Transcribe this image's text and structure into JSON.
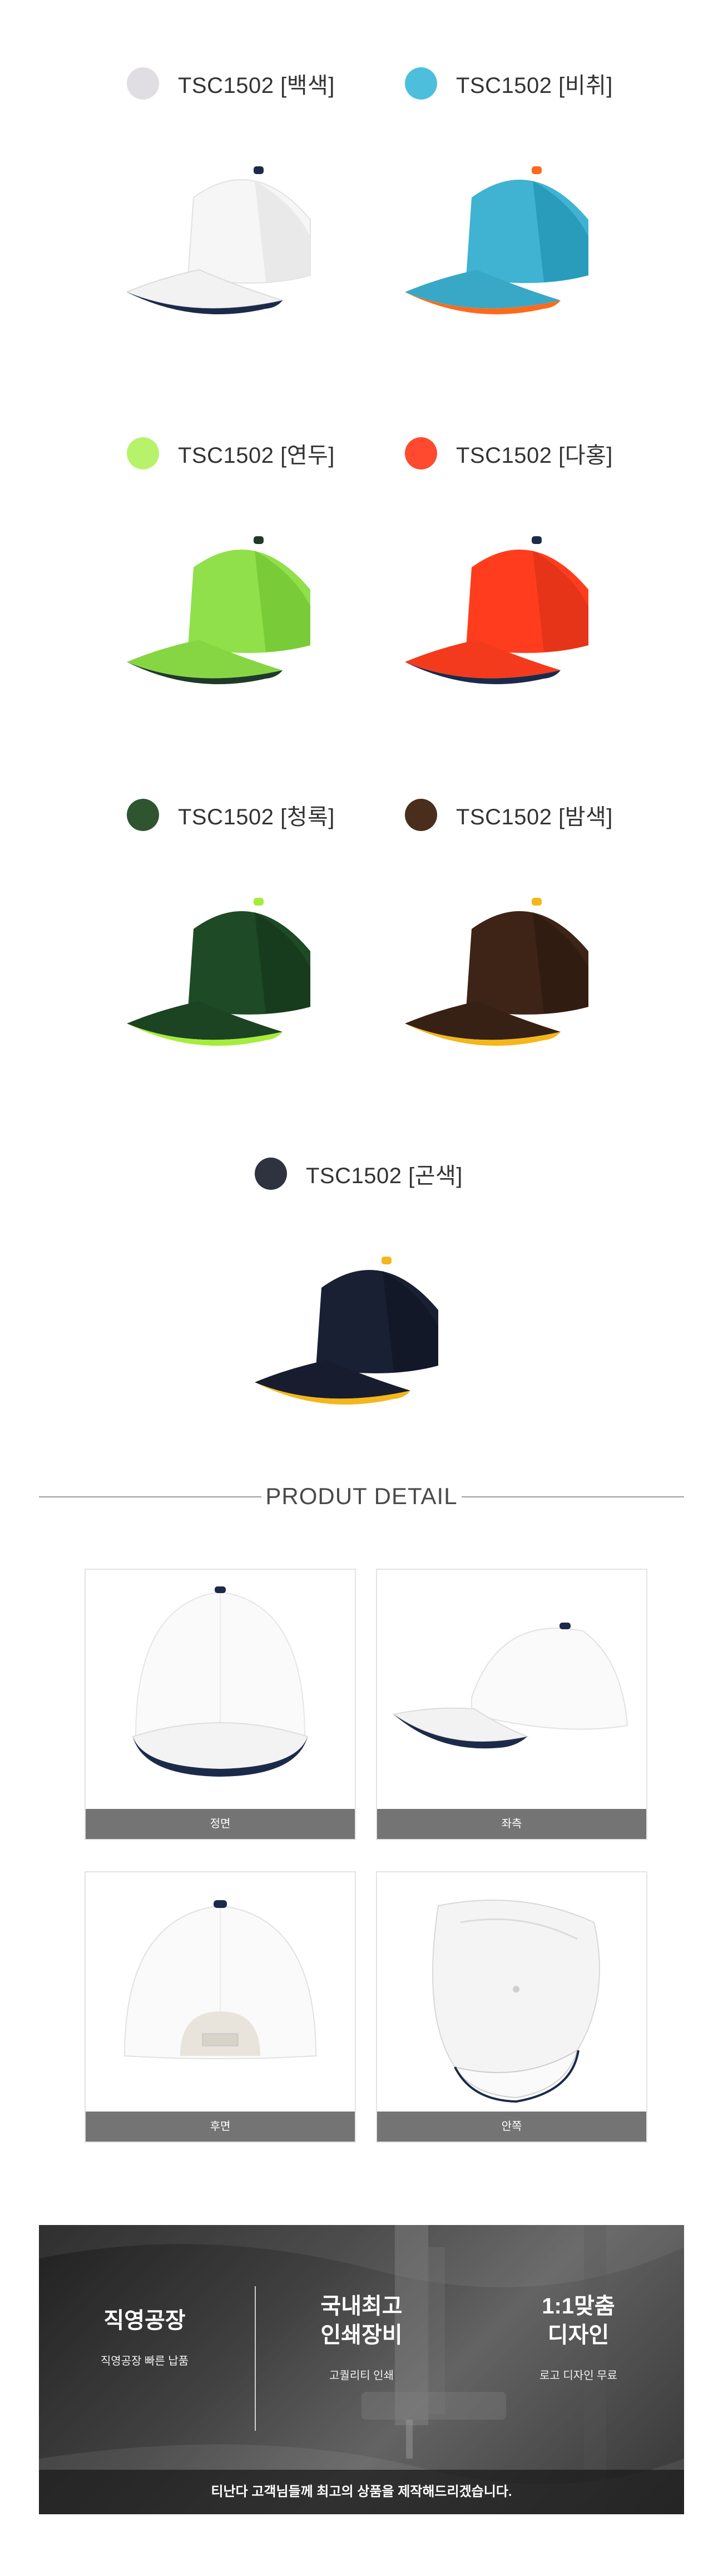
{
  "variants": [
    {
      "label": "TSC1502 [백색]",
      "swatch": "#e0dde3",
      "crown": "#f6f6f6",
      "shade": "#d9d9d9",
      "trim": "#1c2a4a",
      "button": "#1c2a4a"
    },
    {
      "label": "TSC1502 [비취]",
      "swatch": "#4dbfdc",
      "crown": "#3fb3d1",
      "shade": "#2a8aa6",
      "trim": "#ff6a1a",
      "button": "#ff6a1a"
    },
    {
      "label": "TSC1502 [연두]",
      "swatch": "#b7f36a",
      "crown": "#8fe04a",
      "shade": "#6cb32f",
      "trim": "#1f3a2a",
      "button": "#1f3a2a"
    },
    {
      "label": "TSC1502 [다홍]",
      "swatch": "#ff4a30",
      "crown": "#ff3d1e",
      "shade": "#cc2d14",
      "trim": "#1c2a4a",
      "button": "#1c2a4a"
    },
    {
      "label": "TSC1502 [청록]",
      "swatch": "#2e5530",
      "crown": "#1f4a26",
      "shade": "#14331a",
      "trim": "#a6ec3c",
      "button": "#a6ec3c"
    },
    {
      "label": "TSC1502 [밤색]",
      "swatch": "#4a2e1c",
      "crown": "#3d2416",
      "shade": "#26160c",
      "trim": "#f5b61a",
      "button": "#f5b61a"
    },
    {
      "label": "TSC1502 [곤색]",
      "swatch": "#2f3340",
      "crown": "#1a2033",
      "shade": "#0e1220",
      "trim": "#f5b61a",
      "button": "#f5b61a"
    }
  ],
  "detail": {
    "title": "PRODUT DETAIL",
    "views": [
      {
        "caption": "정면",
        "icon": "cap-front-view"
      },
      {
        "caption": "좌측",
        "icon": "cap-left-view"
      },
      {
        "caption": "후면",
        "icon": "cap-back-view"
      },
      {
        "caption": "안쪽",
        "icon": "cap-inside-view"
      }
    ]
  },
  "banner": {
    "features": [
      {
        "title": "직영공장",
        "sub": "직영공장 빠른 납품"
      },
      {
        "title": "국내최고\n인쇄장비",
        "sub": "고퀄리티 인쇄"
      },
      {
        "title": "1:1맞춤\n디자인",
        "sub": "로고 디자인 무료"
      }
    ],
    "footer": "티난다 고객님들께 최고의 상품을 제작해드리겠습니다."
  }
}
